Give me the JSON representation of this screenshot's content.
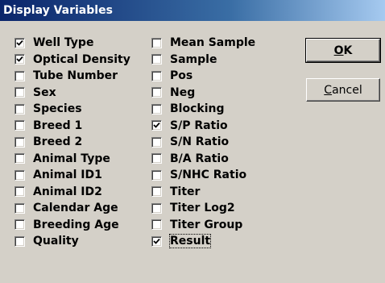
{
  "window": {
    "title": "Display Variables"
  },
  "left_column": [
    {
      "label": "Well Type",
      "checked": true
    },
    {
      "label": "Optical Density",
      "checked": true
    },
    {
      "label": "Tube Number",
      "checked": false
    },
    {
      "label": "Sex",
      "checked": false
    },
    {
      "label": "Species",
      "checked": false
    },
    {
      "label": "Breed 1",
      "checked": false
    },
    {
      "label": "Breed 2",
      "checked": false
    },
    {
      "label": "Animal Type",
      "checked": false
    },
    {
      "label": "Animal ID1",
      "checked": false
    },
    {
      "label": "Animal ID2",
      "checked": false
    },
    {
      "label": "Calendar Age",
      "checked": false
    },
    {
      "label": "Breeding Age",
      "checked": false
    },
    {
      "label": "Quality",
      "checked": false
    }
  ],
  "right_column": [
    {
      "label": "Mean Sample",
      "checked": false
    },
    {
      "label": "Sample",
      "checked": false
    },
    {
      "label": "Pos",
      "checked": false
    },
    {
      "label": "Neg",
      "checked": false
    },
    {
      "label": "Blocking",
      "checked": false
    },
    {
      "label": "S/P Ratio",
      "checked": true
    },
    {
      "label": "S/N Ratio",
      "checked": false
    },
    {
      "label": "B/A Ratio",
      "checked": false
    },
    {
      "label": "S/NHC Ratio",
      "checked": false
    },
    {
      "label": "Titer",
      "checked": false
    },
    {
      "label": "Titer Log2",
      "checked": false
    },
    {
      "label": "Titer Group",
      "checked": false
    },
    {
      "label": "Result",
      "checked": true,
      "focused": true
    }
  ],
  "buttons": {
    "ok": {
      "mnemonic": "O",
      "rest": "K"
    },
    "cancel": {
      "mnemonic": "C",
      "rest": "ancel"
    }
  },
  "icons": {
    "checkmark": "checkmark-icon"
  },
  "colors": {
    "titlebar_start": "#0a246a",
    "titlebar_end": "#a6caf0",
    "face": "#d4d0c8"
  }
}
